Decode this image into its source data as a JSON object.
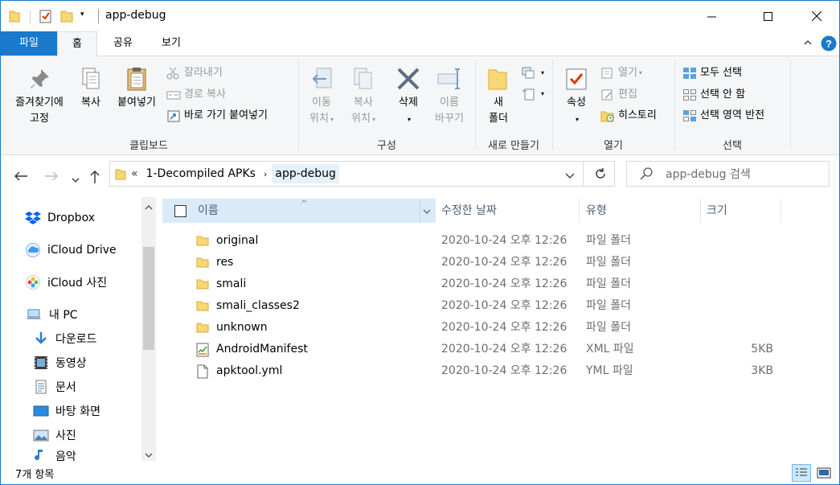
{
  "window": {
    "title": "app-debug",
    "controls": {
      "minimize": "minimize",
      "maximize": "maximize",
      "close": "close"
    }
  },
  "ribbon_tabs": [
    {
      "label": "파일"
    },
    {
      "label": "홈"
    },
    {
      "label": "공유"
    },
    {
      "label": "보기"
    }
  ],
  "ribbon": {
    "clipboard": {
      "label": "클립보드",
      "pin_line1": "즐겨찾기에",
      "pin_line2": "고정",
      "copy": "복사",
      "paste": "붙여넣기",
      "cut": "잘라내기",
      "copy_path": "경로 복사",
      "paste_shortcut": "바로 가기 붙여넣기"
    },
    "organize": {
      "label": "구성",
      "move_line1": "이동",
      "move_line2": "위치",
      "copyto_line1": "복사",
      "copyto_line2": "위치",
      "delete": "삭제",
      "rename_line1": "이름",
      "rename_line2": "바꾸기"
    },
    "new": {
      "label": "새로 만들기",
      "folder_line1": "새",
      "folder_line2": "폴더"
    },
    "open": {
      "label": "열기",
      "properties": "속성",
      "open": "열기",
      "edit": "편집",
      "history": "히스토리"
    },
    "select": {
      "label": "선택",
      "select_all": "모두 선택",
      "select_none": "선택 안 함",
      "invert": "선택 영역 반전"
    }
  },
  "address": {
    "overflow": "«",
    "crumbs": [
      "1-Decompiled APKs",
      "app-debug"
    ],
    "search_placeholder": "app-debug 검색"
  },
  "nav_pane": {
    "items": [
      {
        "label": "Dropbox",
        "icon": "dropbox-icon"
      },
      {
        "label": "iCloud Drive",
        "icon": "icloud-drive-icon"
      },
      {
        "label": "iCloud 사진",
        "icon": "icloud-photos-icon"
      },
      {
        "label": "내 PC",
        "icon": "this-pc-icon"
      },
      {
        "label": "다운로드",
        "icon": "downloads-icon"
      },
      {
        "label": "동영상",
        "icon": "videos-icon"
      },
      {
        "label": "문서",
        "icon": "documents-icon"
      },
      {
        "label": "바탕 화면",
        "icon": "desktop-icon"
      },
      {
        "label": "사진",
        "icon": "pictures-icon"
      },
      {
        "label": "음악",
        "icon": "music-icon"
      }
    ]
  },
  "file_list": {
    "columns": {
      "name": "이름",
      "date": "수정한 날짜",
      "type": "유형",
      "size": "크기"
    },
    "rows": [
      {
        "name": "original",
        "date": "2020-10-24 오후 12:26",
        "type": "파일 폴더",
        "size": "",
        "icon": "folder-icon"
      },
      {
        "name": "res",
        "date": "2020-10-24 오후 12:26",
        "type": "파일 폴더",
        "size": "",
        "icon": "folder-icon"
      },
      {
        "name": "smali",
        "date": "2020-10-24 오후 12:26",
        "type": "파일 폴더",
        "size": "",
        "icon": "folder-icon"
      },
      {
        "name": "smali_classes2",
        "date": "2020-10-24 오후 12:26",
        "type": "파일 폴더",
        "size": "",
        "icon": "folder-icon"
      },
      {
        "name": "unknown",
        "date": "2020-10-24 오후 12:26",
        "type": "파일 폴더",
        "size": "",
        "icon": "folder-icon"
      },
      {
        "name": "AndroidManifest",
        "date": "2020-10-24 오후 12:26",
        "type": "XML 파일",
        "size": "5KB",
        "icon": "xml-file-icon"
      },
      {
        "name": "apktool.yml",
        "date": "2020-10-24 오후 12:26",
        "type": "YML 파일",
        "size": "3KB",
        "icon": "text-file-icon"
      }
    ]
  },
  "status": {
    "item_count": "7개 항목"
  },
  "colors": {
    "accent": "#1979ca",
    "folder": "#f8d775",
    "selection": "#d9ebf9"
  }
}
